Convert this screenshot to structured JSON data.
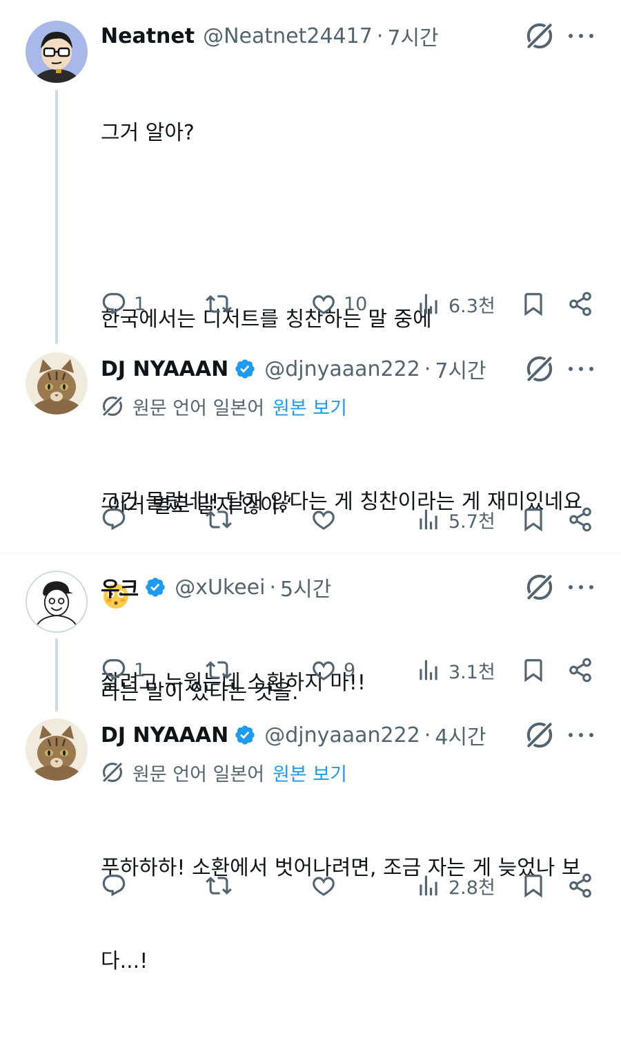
{
  "tweets": [
    {
      "name": "Neatnet",
      "handle": "@Neatnet24417",
      "time": "7시간",
      "avatar": "cartoon-man-glasses",
      "verified": false,
      "lines": [
        "그거 알아?",
        "",
        "한국에서는 디저트를 칭찬하는 말 중에",
        "",
        "’이거 별로 달지 않아.‘",
        "",
        "라는 말이 있다는 것을."
      ],
      "replies": "1",
      "retweets": "",
      "likes": "10",
      "views": "6.3천"
    },
    {
      "name": "DJ NYAAAN",
      "handle": "@djnyaaan222",
      "time": "7시간",
      "avatar": "tabby-cat",
      "verified": true,
      "translate_label": "원문 언어 일본어",
      "translate_show": "원본 보기",
      "lines": [
        "그건 몰랐네!! 달지 않다는 게 칭찬이라는 게 재미있네요"
      ],
      "emoji": "flushed-face",
      "replies": "",
      "retweets": "",
      "likes": "",
      "views": "5.7천"
    },
    {
      "name": "우크",
      "handle": "@xUkeei",
      "time": "5시간",
      "avatar": "line-drawing-man-cap",
      "verified": true,
      "lines": [
        "잘려고 누웠는데 소환하지 마!!"
      ],
      "replies": "1",
      "retweets": "",
      "likes": "9",
      "views": "3.1천"
    },
    {
      "name": "DJ NYAAAN",
      "handle": "@djnyaaan222",
      "time": "4시간",
      "avatar": "tabby-cat",
      "verified": true,
      "translate_label": "원문 언어 일본어",
      "translate_show": "원본 보기",
      "lines": [
        "푸하하하! 소환에서 벗어나려면, 조금 자는 게 늦었나 보",
        "다...!"
      ],
      "replies": "",
      "retweets": "",
      "likes": "",
      "views": "2.8천"
    }
  ],
  "colors": {
    "text": "#0f1419",
    "secondary": "#536471",
    "accent": "#1d9bf0",
    "thread_line": "#cfd9de"
  }
}
